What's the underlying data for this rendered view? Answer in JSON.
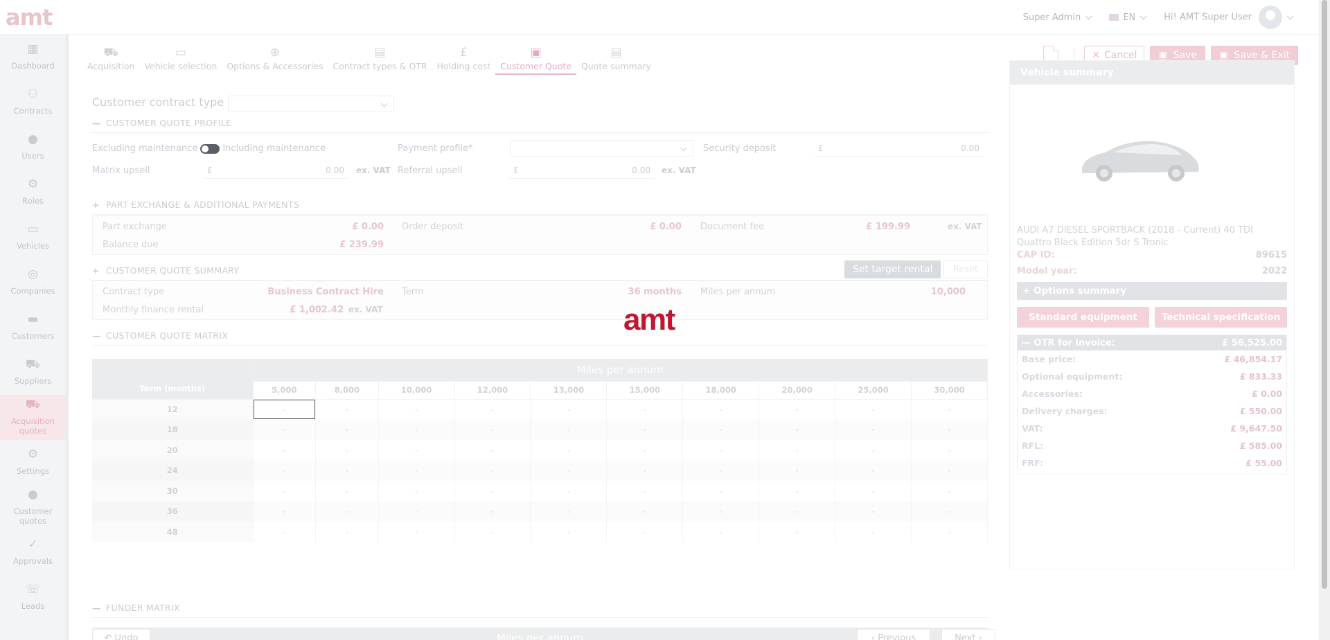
{
  "brand": {
    "logo": "amt",
    "accent": "#c0172f"
  },
  "topbar": {
    "role": "Super Admin",
    "lang": "EN",
    "greeting": "Hi! AMT Super User"
  },
  "sidebar": {
    "items": [
      {
        "label": "Dashboard",
        "icon": "dashboard-icon"
      },
      {
        "label": "Contracts",
        "icon": "contracts-icon"
      },
      {
        "label": "Users",
        "icon": "user-icon"
      },
      {
        "label": "Roles",
        "icon": "roles-icon"
      },
      {
        "label": "Vehicles",
        "icon": "car-icon"
      },
      {
        "label": "Companies",
        "icon": "companies-icon"
      },
      {
        "label": "Customers",
        "icon": "customers-icon"
      },
      {
        "label": "Suppliers",
        "icon": "suppliers-icon"
      },
      {
        "label": "Acquisition quotes",
        "icon": "acquisition-icon"
      },
      {
        "label": "Settings",
        "icon": "gear-icon"
      },
      {
        "label": "Customer quotes",
        "icon": "customer-quotes-icon"
      },
      {
        "label": "Approvals",
        "icon": "approvals-icon"
      },
      {
        "label": "Leads",
        "icon": "leads-icon"
      }
    ]
  },
  "steps": [
    "Acquisition",
    "Vehicle selection",
    "Options & Accessories",
    "Contract types & OTR",
    "Holding cost",
    "Customer Quote",
    "Quote summary"
  ],
  "actions": {
    "cancel": "Cancel",
    "save": "Save",
    "save_exit": "Save & Exit"
  },
  "form": {
    "contract_type_label": "Customer contract type :",
    "profile_title": "CUSTOMER QUOTE PROFILE",
    "excl_maint": "Excluding maintenance",
    "incl_maint": "Including maintenance",
    "payment_profile": "Payment profile*",
    "security_deposit": "Security deposit",
    "security_deposit_value": "0.00",
    "matrix_upsell": "Matrix upsell",
    "matrix_upsell_value": "0.00",
    "referral_upsell": "Referral upsell",
    "referral_upsell_value": "0.00",
    "currency": "£",
    "ex_vat": "ex. VAT"
  },
  "part_exchange": {
    "title": "PART EXCHANGE & ADDITIONAL PAYMENTS",
    "part_exchange_label": "Part exchange",
    "part_exchange_value": "£ 0.00",
    "order_deposit_label": "Order deposit",
    "order_deposit_value": "£ 0.00",
    "document_fee_label": "Document fee",
    "document_fee_value": "£ 199.99",
    "ex_vat": "ex. VAT",
    "balance_due_label": "Balance due",
    "balance_due_value": "£ 239.99"
  },
  "summary": {
    "title": "CUSTOMER QUOTE SUMMARY",
    "set_target": "Set target rental",
    "reset": "Reset",
    "contract_type_label": "Contract type",
    "contract_type_value": "Business Contract Hire",
    "term_label": "Term",
    "term_value": "36 months",
    "miles_label": "Miles per annum",
    "miles_value": "10,000",
    "monthly_label": "Monthly finance rental",
    "monthly_value": "£ 1,002.42",
    "ex_vat": "ex. VAT"
  },
  "matrix": {
    "title": "CUSTOMER QUOTE MATRIX",
    "header": "Miles per annum",
    "term_header": "Term (months)",
    "miles": [
      "5,000",
      "8,000",
      "10,000",
      "12,000",
      "13,000",
      "15,000",
      "18,000",
      "20,000",
      "25,000",
      "30,000"
    ],
    "terms": [
      "12",
      "18",
      "20",
      "24",
      "30",
      "36",
      "48"
    ],
    "empty": "-"
  },
  "funder": {
    "title": "FUNDER MATRIX",
    "header": "Miles per annum"
  },
  "footer": {
    "undo": "Undo",
    "previous": "Previous",
    "next": "Next"
  },
  "vehicle": {
    "title": "Vehicle summary",
    "name": "AUDI A7 DIESEL SPORTBACK (2018 - Current) 40 TDI Quattro Black Edition 5dr S Tronic",
    "cap_label": "CAP ID:",
    "cap_value": "89615",
    "year_label": "Model year:",
    "year_value": "2022",
    "options_summary": "Options summary",
    "standard_equipment": "Standard equipment",
    "technical_spec": "Technical specification",
    "otr_label": "OTR for invoice:",
    "otr_value": "£ 56,525.00",
    "rows": [
      {
        "k": "Base price:",
        "v": "£ 46,854.17"
      },
      {
        "k": "Optional equipment:",
        "v": "£ 833.33"
      },
      {
        "k": "Accessories:",
        "v": "£ 0.00"
      },
      {
        "k": "Delivery charges:",
        "v": "£ 550.00"
      },
      {
        "k": "VAT:",
        "v": "£ 9,647.50"
      },
      {
        "k": "RFL:",
        "v": "£ 585.00"
      },
      {
        "k": "FRF:",
        "v": "£ 55.00"
      }
    ]
  }
}
